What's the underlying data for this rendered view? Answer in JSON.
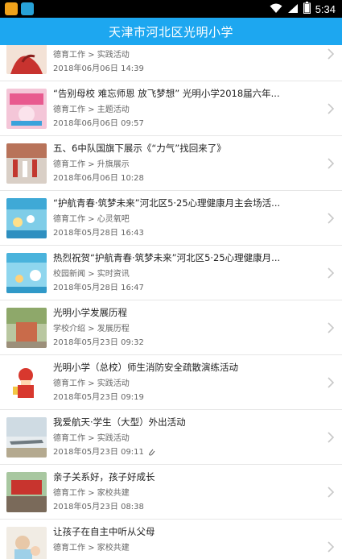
{
  "status_bar": {
    "time": "5:34"
  },
  "header": {
    "title": "天津市河北区光明小学"
  },
  "news_items": [
    {
      "title": "",
      "category": "德育工作 > 实践活动",
      "date": "2018年06月06日 14:39"
    },
    {
      "title": "“告别母校 难忘师恩 放飞梦想” 光明小学2018届六年...",
      "category": "德育工作 > 主题活动",
      "date": "2018年06月06日 09:57"
    },
    {
      "title": "五、6中队国旗下展示《“力气”找回来了》",
      "category": "德育工作 > 升旗展示",
      "date": "2018年06月06日 10:28"
    },
    {
      "title": "“护航青春·筑梦未来”河北区5·25心理健康月主会场活...",
      "category": "德育工作 > 心灵氧吧",
      "date": "2018年05月28日 16:43"
    },
    {
      "title": "热烈祝贺“护航青春·筑梦未来”河北区5·25心理健康月...",
      "category": "校园新闻 > 实时资讯",
      "date": "2018年05月28日 16:47"
    },
    {
      "title": "光明小学发展历程",
      "category": "学校介绍 > 发展历程",
      "date": "2018年05月23日 09:32"
    },
    {
      "title": "光明小学（总校）师生消防安全疏散演练活动",
      "category": "德育工作 > 实践活动",
      "date": "2018年05月23日 09:19"
    },
    {
      "title": "我爱航天·学生（大型）外出活动",
      "category": "德育工作 > 实践活动",
      "date": "2018年05月23日 09:11",
      "attachment": true
    },
    {
      "title": "亲子关系好，孩子好成长",
      "category": "德育工作 > 家校共建",
      "date": "2018年05月23日 08:38"
    },
    {
      "title": "让孩子在自主中听从父母",
      "category": "德育工作 > 家校共建",
      "date": ""
    }
  ],
  "colors": {
    "header": "#1da7f0",
    "title_text": "#222222",
    "meta_text": "#666666",
    "divider": "#e6e6e6"
  },
  "icons": [
    "wifi-icon",
    "signal-icon",
    "battery-icon",
    "chevron-right-icon",
    "paperclip-icon"
  ]
}
